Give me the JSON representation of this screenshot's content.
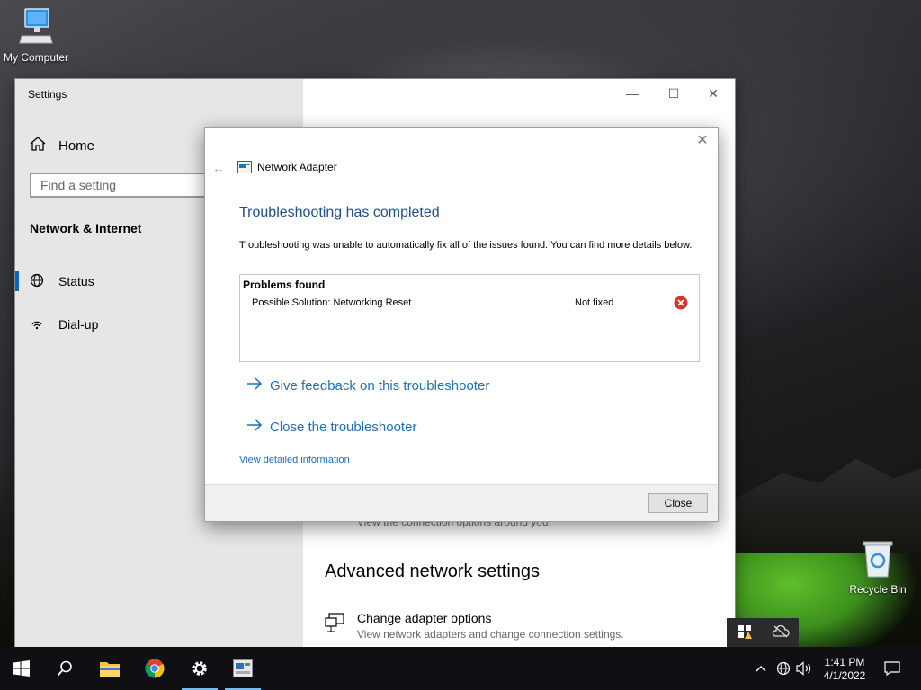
{
  "desktop": {
    "icons": [
      {
        "label": "My Computer"
      },
      {
        "label": "Recycle Bin"
      }
    ]
  },
  "settings": {
    "title": "Settings",
    "home_label": "Home",
    "search_placeholder": "Find a setting",
    "section_title": "Network & Internet",
    "nav_items": [
      {
        "label": "Status",
        "selected": true
      },
      {
        "label": "Dial-up",
        "selected": false
      }
    ],
    "main": {
      "partial_text": "View the connection options around you.",
      "advanced_title": "Advanced network settings",
      "adapter_title": "Change adapter options",
      "adapter_subtitle": "View network adapters and change connection settings."
    }
  },
  "dialog": {
    "app_name": "Network Adapter",
    "heading": "Troubleshooting has completed",
    "description": "Troubleshooting was unable to automatically fix all of the issues found. You can find more details below.",
    "problems_header": "Problems found",
    "problems": [
      {
        "name": "Possible Solution: Networking Reset",
        "status": "Not fixed",
        "status_icon": "error-icon"
      }
    ],
    "links": [
      {
        "label": "Give feedback on this troubleshooter"
      },
      {
        "label": "Close the troubleshooter"
      }
    ],
    "detail_link": "View detailed information",
    "close_button": "Close"
  },
  "taskbar": {
    "time": "1:41 PM",
    "date": "4/1/2022",
    "accent_color": "#76b9ed"
  },
  "colors": {
    "heading_blue": "#1e4e8c",
    "link_blue": "#1e6fb8",
    "error_red": "#d9342b",
    "nav_selected": "#0067c0"
  }
}
